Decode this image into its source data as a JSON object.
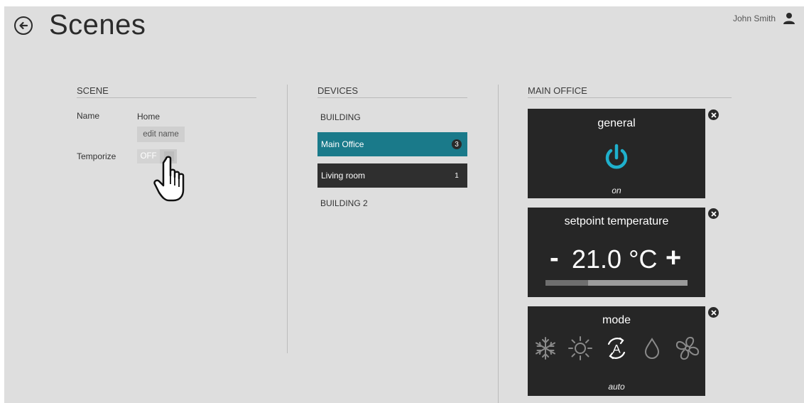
{
  "header": {
    "title": "Scenes",
    "user_name": "John Smith"
  },
  "scene": {
    "section_title": "SCENE",
    "name_label": "Name",
    "name_value": "Home",
    "edit_name_label": "edit name",
    "temporize_label": "Temporize",
    "temporize_state": "OFF"
  },
  "devices": {
    "section_title": "DEVICES",
    "groups": [
      {
        "label": "BUILDING",
        "items": [
          {
            "name": "Main Office",
            "count": "3",
            "selected": true
          },
          {
            "name": "Living room",
            "count": "1",
            "selected": false
          }
        ]
      },
      {
        "label": "BUILDING 2",
        "items": []
      }
    ]
  },
  "main_office": {
    "section_title": "MAIN OFFICE",
    "cards": [
      {
        "title": "general",
        "icon": "power-icon",
        "state": "on"
      },
      {
        "title": "setpoint temperature",
        "minus": "-",
        "value": "21.0 °C",
        "plus": "+",
        "slider_level": 0.3
      },
      {
        "title": "mode",
        "options": [
          "snowflake-icon",
          "sun-icon",
          "auto-icon",
          "droplet-icon",
          "fan-icon"
        ],
        "selected": "auto-icon",
        "state": "auto"
      }
    ]
  },
  "colors": {
    "background": "#dedede",
    "accent": "#1a7a8a",
    "card": "#262626",
    "power_icon": "#1fb0cc",
    "device_dark": "#2f2f2f"
  }
}
